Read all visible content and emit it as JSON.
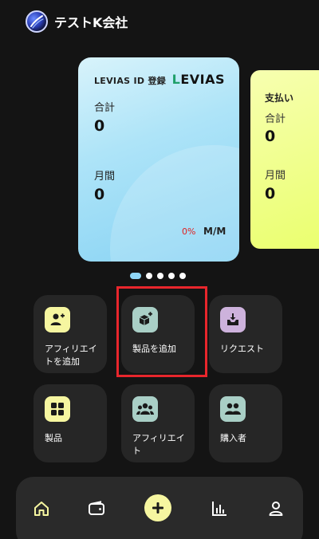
{
  "header": {
    "company_name": "テストK会社",
    "logo_icon": "brand-logo-icon"
  },
  "card_primary": {
    "title": "LEVIAS ID 登録",
    "brand_first": "L",
    "brand_rest": "EVIAS",
    "total_label": "合計",
    "total_value": "0",
    "monthly_label": "月間",
    "monthly_value": "0",
    "change_percent": "0%",
    "period_label": "M/M",
    "accent_change_color": "#e02020"
  },
  "card_secondary": {
    "title": "支払い",
    "total_label": "合計",
    "total_value": "0",
    "monthly_label": "月間",
    "monthly_value": "0"
  },
  "carousel": {
    "page_count": 5,
    "active_index": 0
  },
  "actions": [
    {
      "label": "アフィリエイトを追加",
      "icon": "add-user-icon",
      "color": "#f6f6a0"
    },
    {
      "label": "製品を追加",
      "icon": "add-product-icon",
      "color": "#a9cfc6"
    },
    {
      "label": "リクエスト",
      "icon": "inbox-download-icon",
      "color": "#cdb2dc"
    },
    {
      "label": "製品",
      "icon": "grid-icon",
      "color": "#f6f6a0"
    },
    {
      "label": "アフィリエイト",
      "icon": "people-icon",
      "color": "#a9cfc6"
    },
    {
      "label": "購入者",
      "icon": "buyers-icon",
      "color": "#a9cfc6"
    }
  ],
  "highlighted_action": "製品を追加",
  "bottom_nav": [
    {
      "icon": "home-icon",
      "active": true
    },
    {
      "icon": "wallet-icon",
      "active": false
    },
    {
      "icon": "plus-icon",
      "active": false
    },
    {
      "icon": "bar-chart-icon",
      "active": false
    },
    {
      "icon": "profile-icon",
      "active": false
    }
  ]
}
